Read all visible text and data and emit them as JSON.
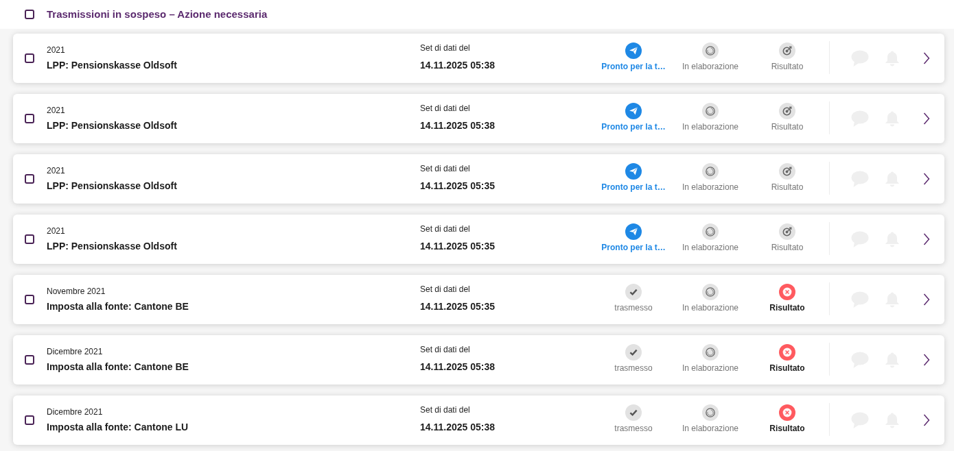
{
  "header": {
    "title": "Trasmissioni in sospeso – Azione necessaria",
    "checked": false
  },
  "rows": [
    {
      "checked": false,
      "period": "2021",
      "title": "LPP: Pensionskasse Oldsoft",
      "dataset_label": "Set di dati del",
      "dataset_date": "14.11.2025 05:38",
      "steps": [
        {
          "label": "Pronto per la t…",
          "current": true,
          "completed": false,
          "failed": false
        },
        {
          "label": "In elaborazione",
          "current": false,
          "completed": false,
          "failed": false
        },
        {
          "label": "Risultato",
          "current": false,
          "completed": false,
          "failed": false
        }
      ]
    },
    {
      "checked": false,
      "period": "2021",
      "title": "LPP: Pensionskasse Oldsoft",
      "dataset_label": "Set di dati del",
      "dataset_date": "14.11.2025 05:38",
      "steps": [
        {
          "label": "Pronto per la t…",
          "current": true,
          "completed": false,
          "failed": false
        },
        {
          "label": "In elaborazione",
          "current": false,
          "completed": false,
          "failed": false
        },
        {
          "label": "Risultato",
          "current": false,
          "completed": false,
          "failed": false
        }
      ]
    },
    {
      "checked": false,
      "period": "2021",
      "title": "LPP: Pensionskasse Oldsoft",
      "dataset_label": "Set di dati del",
      "dataset_date": "14.11.2025 05:35",
      "steps": [
        {
          "label": "Pronto per la t…",
          "current": true,
          "completed": false,
          "failed": false
        },
        {
          "label": "In elaborazione",
          "current": false,
          "completed": false,
          "failed": false
        },
        {
          "label": "Risultato",
          "current": false,
          "completed": false,
          "failed": false
        }
      ]
    },
    {
      "checked": false,
      "period": "2021",
      "title": "LPP: Pensionskasse Oldsoft",
      "dataset_label": "Set di dati del",
      "dataset_date": "14.11.2025 05:35",
      "steps": [
        {
          "label": "Pronto per la t…",
          "current": true,
          "completed": false,
          "failed": false
        },
        {
          "label": "In elaborazione",
          "current": false,
          "completed": false,
          "failed": false
        },
        {
          "label": "Risultato",
          "current": false,
          "completed": false,
          "failed": false
        }
      ]
    },
    {
      "checked": false,
      "period": "Novembre 2021",
      "title": "Imposta alla fonte: Cantone BE",
      "dataset_label": "Set di dati del",
      "dataset_date": "14.11.2025 05:35",
      "steps": [
        {
          "label": "trasmesso",
          "current": false,
          "completed": true,
          "failed": false
        },
        {
          "label": "In elaborazione",
          "current": false,
          "completed": false,
          "failed": false
        },
        {
          "label": "Risultato",
          "current": false,
          "completed": false,
          "failed": true
        }
      ]
    },
    {
      "checked": false,
      "period": "Dicembre 2021",
      "title": "Imposta alla fonte: Cantone BE",
      "dataset_label": "Set di dati del",
      "dataset_date": "14.11.2025 05:38",
      "steps": [
        {
          "label": "trasmesso",
          "current": false,
          "completed": true,
          "failed": false
        },
        {
          "label": "In elaborazione",
          "current": false,
          "completed": false,
          "failed": false
        },
        {
          "label": "Risultato",
          "current": false,
          "completed": false,
          "failed": true
        }
      ]
    },
    {
      "checked": false,
      "period": "Dicembre 2021",
      "title": "Imposta alla fonte: Cantone LU",
      "dataset_label": "Set di dati del",
      "dataset_date": "14.11.2025 05:38",
      "steps": [
        {
          "label": "trasmesso",
          "current": false,
          "completed": true,
          "failed": false
        },
        {
          "label": "In elaborazione",
          "current": false,
          "completed": false,
          "failed": false
        },
        {
          "label": "Risultato",
          "current": false,
          "completed": false,
          "failed": true
        }
      ]
    }
  ]
}
